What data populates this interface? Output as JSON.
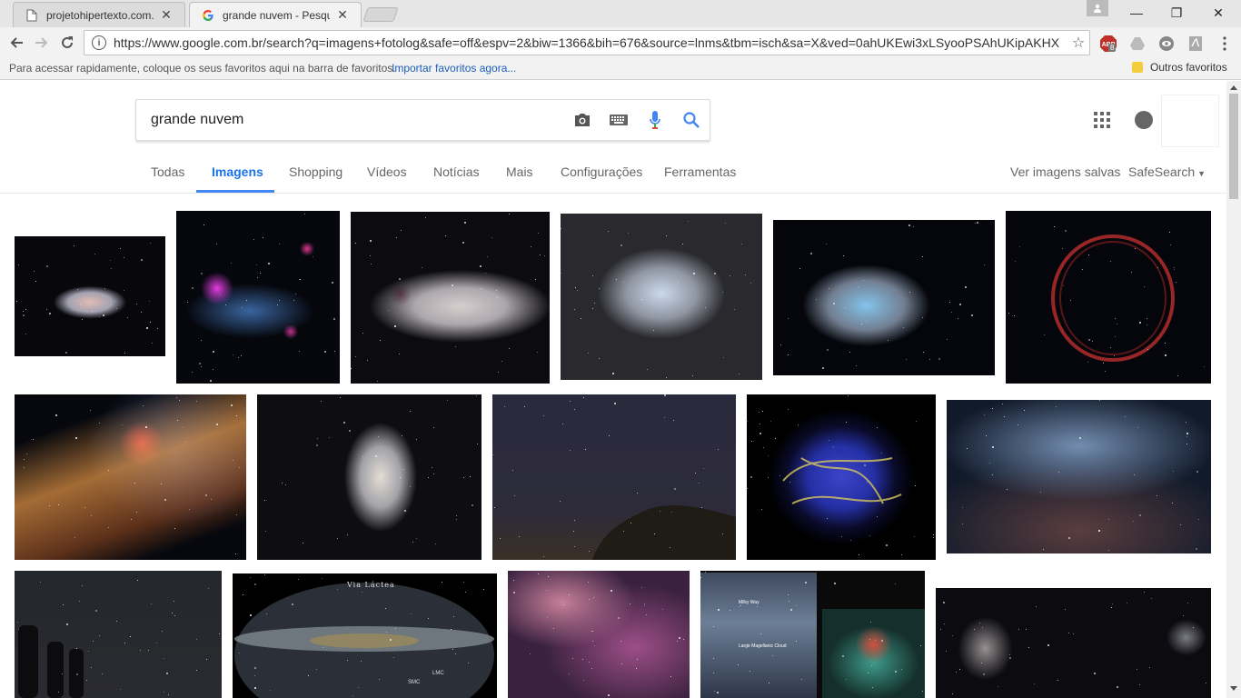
{
  "browser": {
    "tabs": [
      {
        "title": "projetohipertexto.com.br",
        "close": "✕"
      },
      {
        "title": "grande nuvem - Pesquisa",
        "close": "✕"
      }
    ],
    "window_controls": {
      "minimize": "—",
      "restore": "❐",
      "close": "✕"
    },
    "url": "https://www.google.com.br/search?q=imagens+fotolog&safe=off&espv=2&biw=1366&bih=676&source=lnms&tbm=isch&sa=X&ved=0ahUKEwi3xLSyooPSAhUKipAKHX",
    "bookmarks_bar": {
      "hint": "Para acessar rapidamente, coloque os seus favoritos aqui na barra de favoritos.",
      "import_link": "Importar favoritos agora...",
      "other_folder": "Outros favoritos"
    },
    "extension_badge": "8"
  },
  "search": {
    "query": "grande nuvem"
  },
  "nav": {
    "tabs": [
      "Todas",
      "Imagens",
      "Shopping",
      "Vídeos",
      "Notícias",
      "Mais",
      "Configurações",
      "Ferramentas"
    ],
    "active_tab": "Imagens",
    "saved_images": "Ver imagens salvas",
    "safesearch": "SafeSearch"
  },
  "thumbnails": {
    "row1": [
      "lmc-starfield",
      "lmc-pink-nebulae",
      "lmc-wide-bar",
      "lmc-blue-grainy",
      "smc-blue-cloud",
      "red-ring-remnant"
    ],
    "row2": [
      "lmc-colorful-bar",
      "lmc-gray-dim",
      "night-sky-trees",
      "blue-xray-remnant",
      "nebula-filaments"
    ],
    "row3": [
      "moai-night-sky",
      "via-lactea-panorama",
      "pink-nebula-closeup",
      "milky-way-labeled",
      "two-clouds-dark"
    ]
  },
  "panorama_labels": {
    "title": "Via Láctea",
    "smc": "SMC",
    "lmc": "LMC"
  },
  "labeled_image": {
    "milky_way": "Milky Way",
    "lmc": "Large Magellanic Cloud"
  }
}
